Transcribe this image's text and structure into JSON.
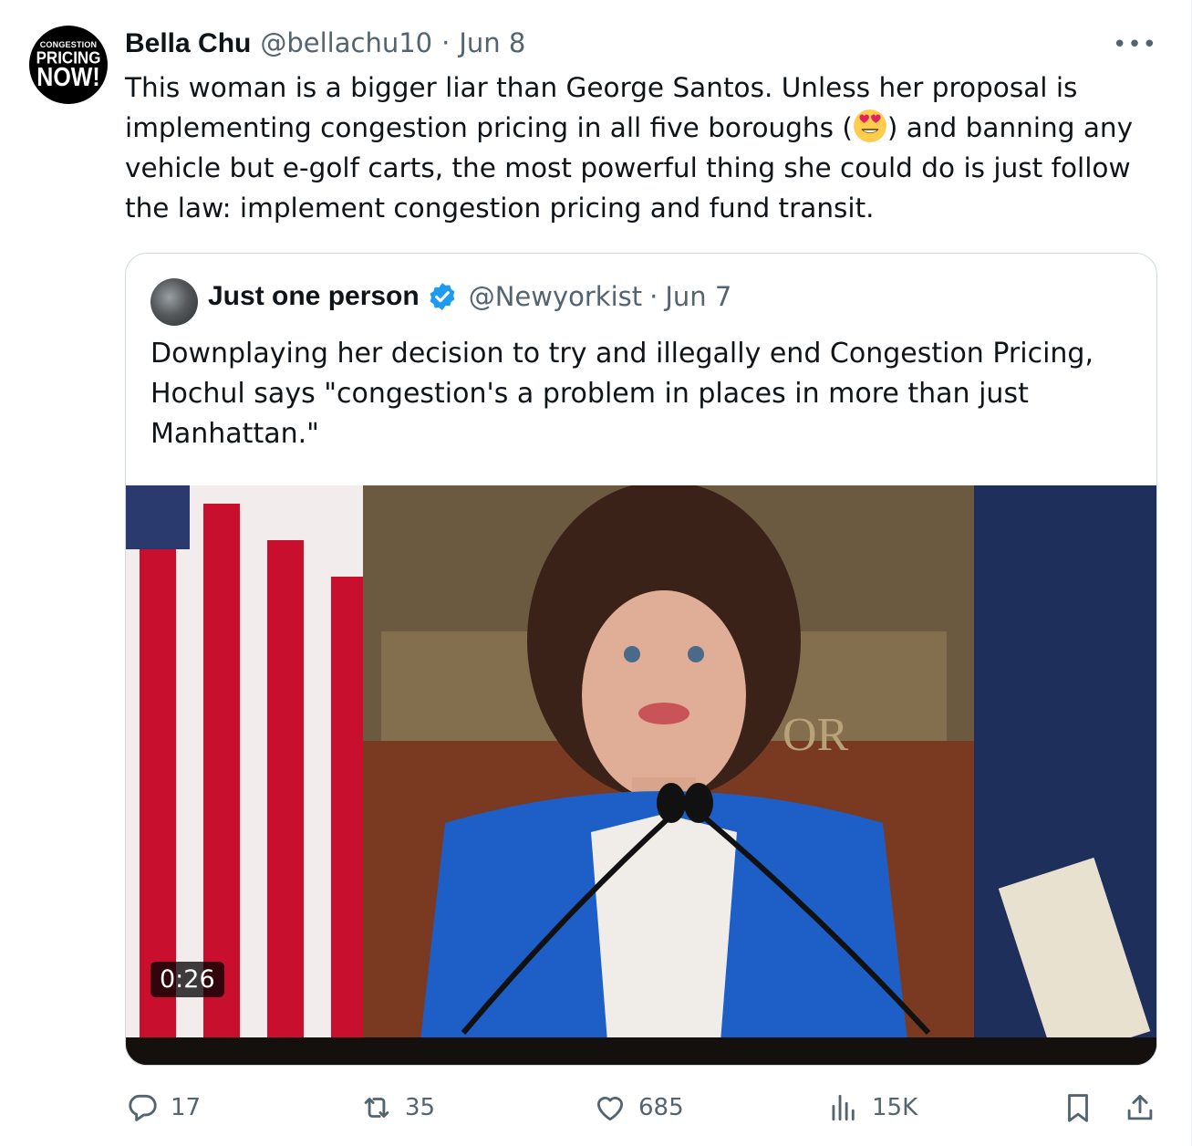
{
  "tweet": {
    "author_name": "Bella Chu",
    "author_handle": "@bellachu10",
    "separator": "·",
    "date": "Jun 8",
    "text_part1": "This woman is a bigger liar than George Santos. Unless her proposal is implementing congestion pricing in all five boroughs (",
    "text_part2": ") and banning any vehicle but e-golf carts, the most powerful thing she could do is just follow the law: implement congestion pricing and fund transit.",
    "avatar_lines": [
      "CONGESTION",
      "PRICING",
      "NOW!"
    ],
    "more_label": "•••"
  },
  "quote": {
    "author_name": "Just one person",
    "author_handle": "@Newyorkist",
    "separator": "·",
    "date": "Jun 7",
    "text": "Downplaying her decision to try and illegally end Congestion Pricing, Hochul says \"congestion's a problem in places in more than just Manhattan.\"",
    "video_duration": "0:26",
    "verified_color": "#1d9bf0"
  },
  "actions": {
    "replies": "17",
    "reposts": "35",
    "likes": "685",
    "views": "15K"
  },
  "icons": {
    "reply": "reply-icon",
    "repost": "repost-icon",
    "like": "heart-icon",
    "views": "views-icon",
    "bookmark": "bookmark-icon",
    "share": "share-icon"
  },
  "colors": {
    "text": "#0f1419",
    "muted": "#536471",
    "border": "#cfd9de"
  }
}
